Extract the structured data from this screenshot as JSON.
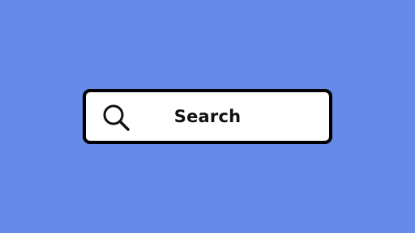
{
  "colors": {
    "background": "#6789e8",
    "box_fill": "#ffffff",
    "box_border": "#000000",
    "text": "#111111"
  },
  "search": {
    "label": "Search",
    "icon": "search-icon"
  }
}
